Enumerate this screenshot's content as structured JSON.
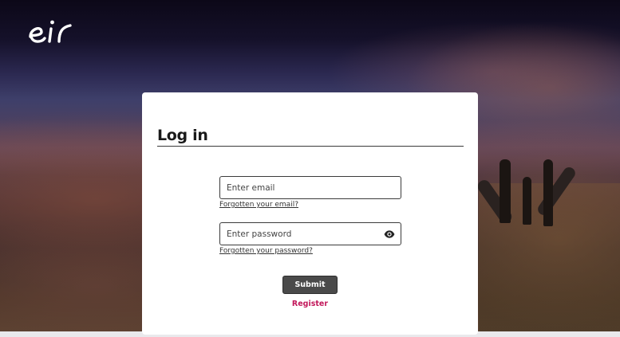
{
  "brand": {
    "logo_text": "eir",
    "logo_icon": "eir-logo-icon"
  },
  "login": {
    "title": "Log in",
    "email": {
      "value": "",
      "placeholder": "Enter email",
      "forgot_link": "Forgotten your email?"
    },
    "password": {
      "value": "",
      "placeholder": "Enter password",
      "toggle_icon": "eye-icon",
      "forgot_link": "Forgotten your password?"
    },
    "submit_label": "Submit",
    "register_label": "Register"
  },
  "colors": {
    "register_link": "#c2185b",
    "submit_button": "#4a4a4a",
    "card_background": "#ffffff"
  }
}
